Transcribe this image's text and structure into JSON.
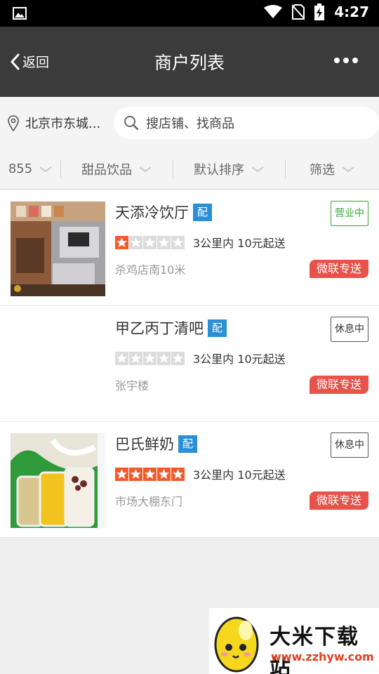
{
  "status_bar": {
    "time": "4:27"
  },
  "header": {
    "back_label": "返回",
    "title": "商户列表"
  },
  "search": {
    "location": "北京市东城...",
    "placeholder": "搜店铺、找商品"
  },
  "filters": [
    {
      "label": "855"
    },
    {
      "label": "甜品饮品"
    },
    {
      "label": "默认排序"
    },
    {
      "label": "筛选"
    }
  ],
  "shops": [
    {
      "name": "天添冷饮厅",
      "badge": "配",
      "status": "营业中",
      "status_type": "open",
      "rating": 1,
      "delivery": "3公里内 10元起送",
      "address": "杀鸡店南10米",
      "tag": "微联专送"
    },
    {
      "name": "甲乙丙丁清吧",
      "badge": "配",
      "status": "休息中",
      "status_type": "closed",
      "rating": 0,
      "delivery": "3公里内 10元起送",
      "address": "张宇楼",
      "tag": "微联专送"
    },
    {
      "name": "巴氏鲜奶",
      "badge": "配",
      "status": "休息中",
      "status_type": "closed",
      "rating": 5,
      "delivery": "3公里内 10元起送",
      "address": "市场大棚东门",
      "tag": "微联专送"
    }
  ],
  "watermark": {
    "title": "大米下载站",
    "url": "www.zzhyw.com"
  },
  "colors": {
    "header": "#3b3b3b",
    "badge": "#2a8fd6",
    "tag": "#e5534b",
    "open": "#3aa53a",
    "star": "#f25a2a"
  }
}
